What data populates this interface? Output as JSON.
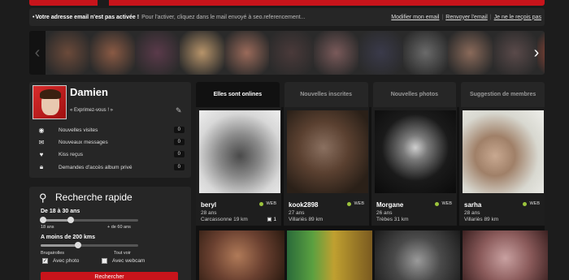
{
  "notice": {
    "warning": "Votre adresse email n'est pas activée !",
    "info": "Pour l'activer, cliquez dans le mail envoyé à seo.referencement...",
    "links": [
      "Modifier mon email",
      "Renvoyer l'email",
      "Je ne le reçois pas"
    ]
  },
  "strip": {
    "thumb_colors": [
      "#6b4a3a",
      "#8a5a44",
      "#5a3a4a",
      "#b7946a",
      "#9a6a5a",
      "#4a3a3a",
      "#7a5a5a",
      "#3a3a4a",
      "#6a6a6a",
      "#8a6a5a",
      "#5a4a4a",
      "#b8503a"
    ]
  },
  "profile": {
    "name": "Damien",
    "mood": "« Exprimez-vous ! »",
    "stats": [
      {
        "icon": "eye-icon",
        "label": "Nouvelles visites",
        "count": "0"
      },
      {
        "icon": "envelope-icon",
        "label": "Nouveaux messages",
        "count": "0"
      },
      {
        "icon": "heart-icon",
        "label": "Kiss reçus",
        "count": "0"
      },
      {
        "icon": "lock-icon",
        "label": "Demandes d'accès album privé",
        "count": "0"
      }
    ]
  },
  "search": {
    "title": "Recherche rapide",
    "age_label": "De 18 à 30 ans",
    "age_min": "18 ans",
    "age_max": "+ de 60 ans",
    "distance_label": "A moins de 200 kms",
    "dist_min": "Brugairolles",
    "dist_max": "Tout voir",
    "with_photo": "Avec photo",
    "with_webcam": "Avec webcam",
    "button": "Rechercher",
    "age_range_years": [
      18,
      30
    ],
    "distance_km": 200
  },
  "tabs": [
    "Elles sont onlines",
    "Nouvelles inscrites",
    "Nouvelles photos",
    "Suggestion de membres"
  ],
  "members": [
    {
      "name": "beryl",
      "age": "28 ans",
      "location": "Carcassonne 19 km",
      "status": "WEB",
      "photos": "1"
    },
    {
      "name": "kook2898",
      "age": "27 ans",
      "location": "Villariès 89 km",
      "status": "WEB"
    },
    {
      "name": "Morgane",
      "age": "26 ans",
      "location": "Trèbes 31 km",
      "status": "WEB"
    },
    {
      "name": "sarha",
      "age": "28 ans",
      "location": "Villariès 89 km",
      "status": "WEB"
    }
  ]
}
